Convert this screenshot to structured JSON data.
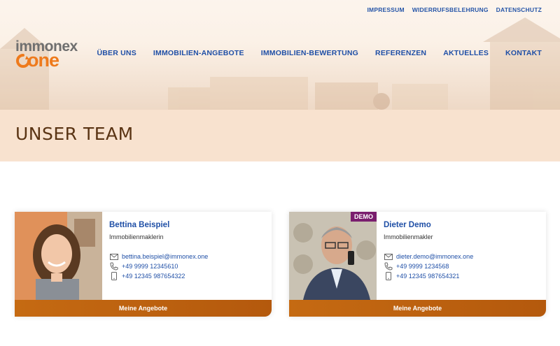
{
  "topnav": {
    "impressum": "IMPRESSUM",
    "widerruf": "WIDERRUFSBELEHRUNG",
    "datenschutz": "DATENSCHUTZ"
  },
  "logo": {
    "line1": "immonex",
    "line2": "one"
  },
  "mainnav": {
    "items": [
      "ÜBER UNS",
      "IMMOBILIEN-ANGEBOTE",
      "IMMOBILIEN-BEWERTUNG",
      "REFERENZEN",
      "AKTUELLES",
      "KONTAKT"
    ]
  },
  "page": {
    "title": "UNSER TEAM"
  },
  "team": [
    {
      "name": "Bettina Beispiel",
      "role": "Immobilienmaklerin",
      "email": "bettina.beispiel@immonex.one",
      "phone": "+49 9999 12345610",
      "mobile": "+49 12345 987654322",
      "button": "Meine Angebote"
    },
    {
      "name": "Dieter Demo",
      "role": "Immobilienmakler",
      "email": "dieter.demo@immonex.one",
      "phone": "+49 9999 1234568",
      "mobile": "+49 12345 987654321",
      "button": "Meine Angebote",
      "badge": "DEMO"
    }
  ],
  "colors": {
    "accent": "#ee7a1c",
    "link": "#1f4fa6",
    "button": "#c56a12",
    "band": "#f8e2cf",
    "title": "#5a3414"
  },
  "icons": [
    "mail-icon",
    "phone-icon",
    "mobile-icon"
  ]
}
